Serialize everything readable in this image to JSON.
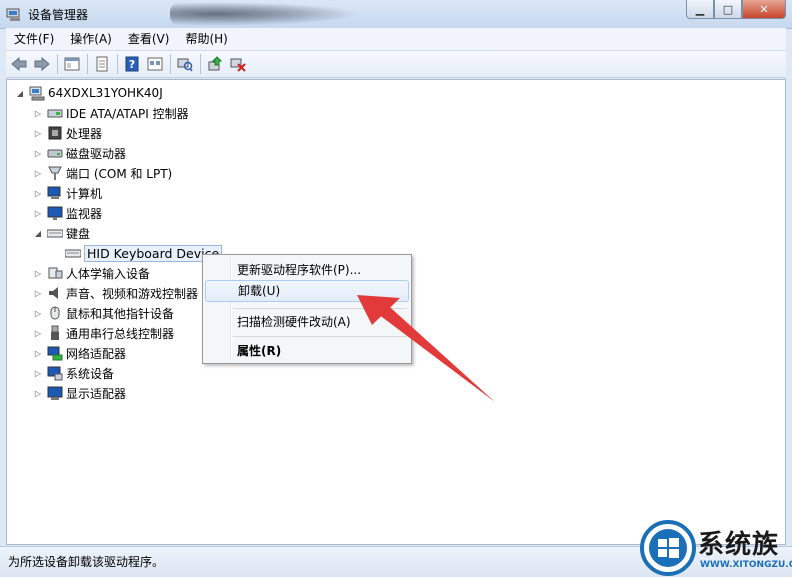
{
  "window": {
    "title": "设备管理器",
    "buttons": {
      "minimize": "▁",
      "maximize": "□",
      "close": "✕"
    }
  },
  "menubar": {
    "items": [
      "文件(F)",
      "操作(A)",
      "查看(V)",
      "帮助(H)"
    ]
  },
  "tree": {
    "root": "64XDXL31YOHK40J",
    "categories": [
      "IDE ATA/ATAPI 控制器",
      "处理器",
      "磁盘驱动器",
      "端口 (COM 和 LPT)",
      "计算机",
      "监视器",
      "键盘",
      "人体学输入设备",
      "声音、视频和游戏控制器",
      "鼠标和其他指针设备",
      "通用串行总线控制器",
      "网络适配器",
      "系统设备",
      "显示适配器"
    ],
    "keyboard_child": "HID Keyboard Device"
  },
  "context_menu": {
    "items": [
      {
        "label": "更新驱动程序软件(P)...",
        "state": "normal"
      },
      {
        "label": "卸载(U)",
        "state": "highlighted"
      },
      {
        "label": "扫描检测硬件改动(A)",
        "state": "normal"
      },
      {
        "label": "属性(R)",
        "state": "bold"
      }
    ]
  },
  "statusbar": {
    "text": "为所选设备卸载该驱动程序。"
  },
  "watermark": {
    "name": "系统族",
    "url": "WWW.XITONGZU.COM"
  },
  "colors": {
    "accent": "#1b6fb7",
    "arrow": "#e23a3a",
    "close": "#c7452b"
  }
}
